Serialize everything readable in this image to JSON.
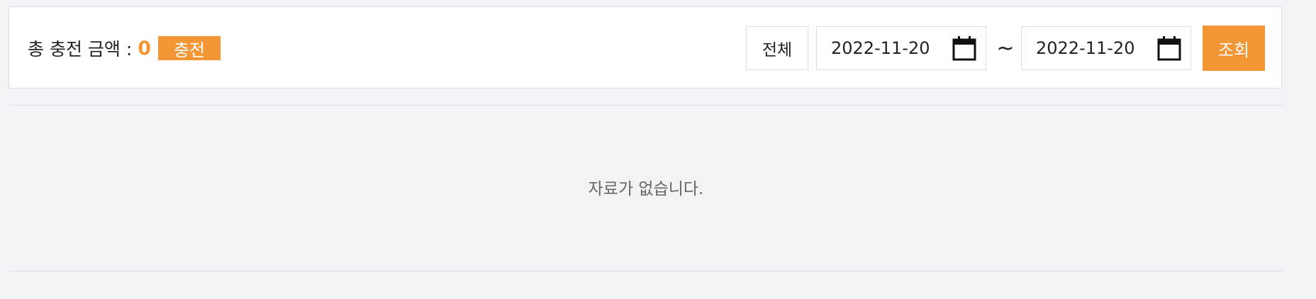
{
  "summary": {
    "total_label": "총 충전 금액 :",
    "total_amount": "0",
    "charge_button_label": "충전"
  },
  "filters": {
    "all_button_label": "전체",
    "date_from": "2022-11-20",
    "separator": "~",
    "date_to": "2022-11-20",
    "search_button_label": "조회"
  },
  "results": {
    "empty_message": "자료가 없습니다."
  },
  "icons": {
    "date_picker": "calendar-icon"
  },
  "colors": {
    "accent": "#f39635",
    "background": "#f2f3f7",
    "border": "#dcdfe6"
  }
}
